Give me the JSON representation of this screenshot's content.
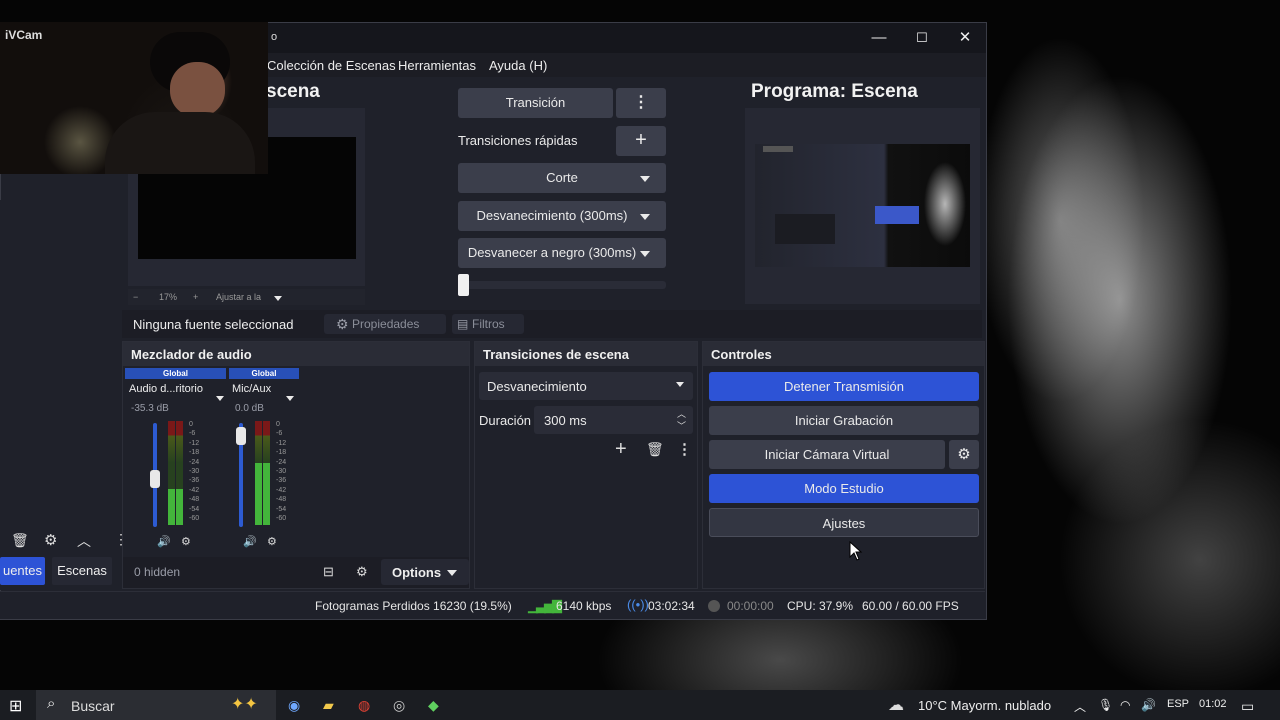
{
  "webcam": {
    "label": "iVCam"
  },
  "window": {
    "title_fragment": "o",
    "minimize": "—",
    "maximize": "☐",
    "close": "✕"
  },
  "menu": [
    "Colección de Escenas",
    "Herramientas",
    "Ayuda (H)"
  ],
  "preview": {
    "title_fragment": "scena",
    "zoom_minus": "−",
    "zoom_value": "17%",
    "zoom_plus": "+",
    "fit_label": "Ajustar a la"
  },
  "transition_panel": {
    "transition_button": "Transición",
    "quick_label": "Transiciones rápidas",
    "quick": [
      "Corte",
      "Desvanecimiento (300ms)",
      "Desvanecer a negro (300ms)"
    ]
  },
  "program": {
    "title": "Programa: Escena"
  },
  "source_bar": {
    "text": "Ninguna fuente seleccionad",
    "properties": "Propiedades",
    "filters": "Filtros"
  },
  "mixer": {
    "title": "Mezclador de audio",
    "channels": [
      {
        "tag": "Global",
        "name": "Audio d...ritorio",
        "db": "-35.3 dB",
        "level": 0.35,
        "fader": 0.45
      },
      {
        "tag": "Global",
        "name": "Mic/Aux",
        "db": "0.0 dB",
        "level": 0.6,
        "fader": 0.95
      }
    ],
    "scale": [
      "0",
      "-6",
      "-12",
      "-18",
      "-24",
      "-30",
      "-36",
      "-42",
      "-48",
      "-54",
      "-60"
    ],
    "hidden": "0 hidden",
    "options": "Options"
  },
  "scene_transitions": {
    "title": "Transiciones de escena",
    "selected": "Desvanecimiento",
    "duration_label": "Duración",
    "duration_value": "300 ms"
  },
  "controls": {
    "title": "Controles",
    "stop_stream": "Detener Transmisión",
    "start_recording": "Iniciar Grabación",
    "virtual_cam": "Iniciar Cámara Virtual",
    "studio_mode": "Modo Estudio",
    "settings": "Ajustes"
  },
  "left_tabs": [
    "uentes",
    "Escenas"
  ],
  "status": {
    "dropped": "Fotogramas Perdidos 16230 (19.5%)",
    "bitrate": "6140 kbps",
    "stream_time": "03:02:34",
    "rec_time": "00:00:00",
    "cpu": "CPU: 37.9%",
    "fps": "60.00 / 60.00 FPS"
  },
  "taskbar": {
    "search_placeholder": "Buscar",
    "weather": "10°C  Mayorm. nublado",
    "lang": "ESP",
    "time": "01:02"
  },
  "colors": {
    "accent_blue": "#2d53d6",
    "button": "#3b3e4b",
    "panel": "#1f212a"
  }
}
